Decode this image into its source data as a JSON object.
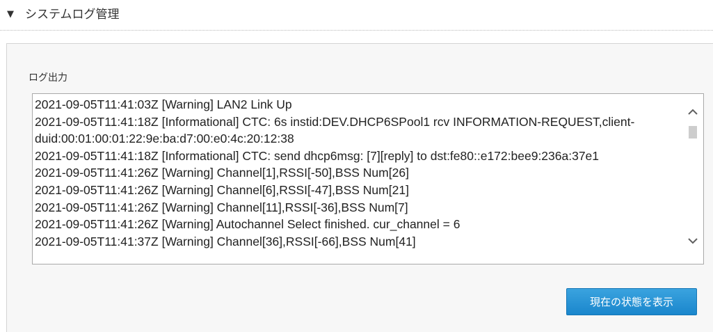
{
  "section": {
    "toggle_icon": "triangle-down-icon",
    "title": "システムログ管理"
  },
  "log": {
    "label": "ログ出力",
    "lines": [
      "2021-09-05T11:41:03Z [Warning] LAN2 Link Up",
      "2021-09-05T11:41:18Z [Informational] CTC: 6s instid:DEV.DHCP6SPool1 rcv INFORMATION-REQUEST,client-duid:00:01:00:01:22:9e:ba:d7:00:e0:4c:20:12:38",
      "2021-09-05T11:41:18Z [Informational] CTC: send dhcp6msg: [7][reply] to dst:fe80::e172:bee9:236a:37e1",
      "2021-09-05T11:41:26Z [Warning] Channel[1],RSSI[-50],BSS Num[26]",
      "2021-09-05T11:41:26Z [Warning] Channel[6],RSSI[-47],BSS Num[21]",
      "2021-09-05T11:41:26Z [Warning] Channel[11],RSSI[-36],BSS Num[7]",
      "2021-09-05T11:41:26Z [Warning] Autochannel Select finished. cur_channel = 6",
      "2021-09-05T11:41:37Z [Warning] Channel[36],RSSI[-66],BSS Num[41]"
    ],
    "scroll_position": 0.05
  },
  "buttons": {
    "show_status": "現在の状態を表示"
  },
  "colors": {
    "button_bg": "#1a86cc",
    "panel_bg": "#f7f7f7"
  }
}
